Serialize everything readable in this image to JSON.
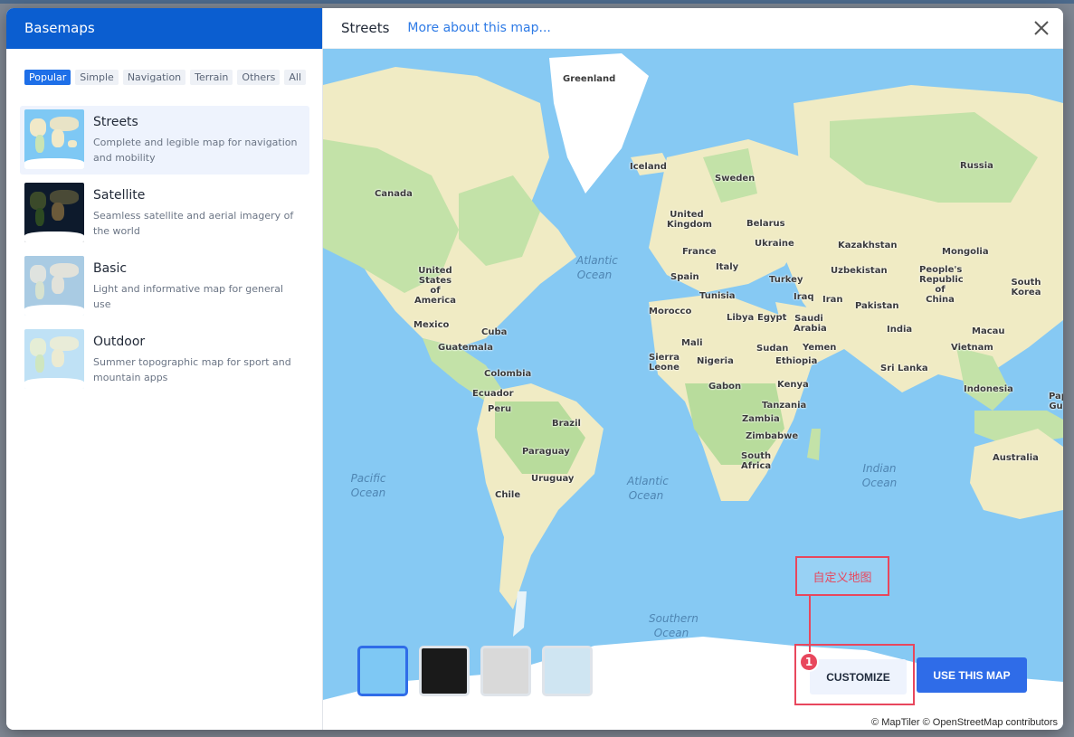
{
  "sidebar": {
    "title": "Basemaps",
    "filters": [
      "Popular",
      "Simple",
      "Navigation",
      "Terrain",
      "Others",
      "All"
    ],
    "active_filter": "Popular",
    "items": [
      {
        "title": "Streets",
        "desc": "Complete and legible map for navigation and mobility",
        "thumb": "streets"
      },
      {
        "title": "Satellite",
        "desc": "Seamless satellite and aerial imagery of the world",
        "thumb": "satellite"
      },
      {
        "title": "Basic",
        "desc": "Light and informative map for general use",
        "thumb": "basic"
      },
      {
        "title": "Outdoor",
        "desc": "Summer topographic map for sport and mountain apps",
        "thumb": "outdoor"
      }
    ]
  },
  "header": {
    "map_name": "Streets",
    "more_link": "More about this map..."
  },
  "map": {
    "labels": {
      "greenland": "Greenland",
      "iceland": "Iceland",
      "canada": "Canada",
      "russia": "Russia",
      "sweden": "Sweden",
      "united_kingdom": "United Kingdom",
      "belarus": "Belarus",
      "france": "France",
      "ukraine": "Ukraine",
      "kazakhstan": "Kazakhstan",
      "mongolia": "Mongolia",
      "spain": "Spain",
      "italy": "Italy",
      "uzbekistan": "Uzbekistan",
      "china": "People's Republic of China",
      "turkey": "Turkey",
      "south_korea": "South Korea",
      "usa": "United States of America",
      "tunisia": "Tunisia",
      "iraq": "Iraq",
      "iran": "Iran",
      "pakistan": "Pakistan",
      "morocco": "Morocco",
      "libya": "Libya",
      "egypt": "Egypt",
      "saudi": "Saudi Arabia",
      "india": "India",
      "macau": "Macau",
      "mexico": "Mexico",
      "cuba": "Cuba",
      "guatemala": "Guatemala",
      "mali": "Mali",
      "sudan": "Sudan",
      "yemen": "Yemen",
      "vietnam": "Vietnam",
      "sierra_leone": "Sierra Leone",
      "nigeria": "Nigeria",
      "ethiopia": "Ethiopia",
      "sri_lanka": "Sri Lanka",
      "colombia": "Colombia",
      "ecuador": "Ecuador",
      "gabon": "Gabon",
      "kenya": "Kenya",
      "indonesia": "Indonesia",
      "papua": "Papu Gu",
      "peru": "Peru",
      "tanzania": "Tanzania",
      "brazil": "Brazil",
      "zambia": "Zambia",
      "zimbabwe": "Zimbabwe",
      "paraguay": "Paraguay",
      "south_africa": "South Africa",
      "australia": "Australia",
      "uruguay": "Uruguay",
      "chile": "Chile"
    },
    "oceans": {
      "atlantic_north": "Atlantic Ocean",
      "pacific": "Pacific Ocean",
      "atlantic_south": "Atlantic Ocean",
      "indian": "Indian Ocean",
      "southern": "Southern Ocean"
    },
    "attribution": "© MapTiler © OpenStreetMap contributors"
  },
  "actions": {
    "customize": "CUSTOMIZE",
    "use_map": "USE THIS MAP"
  },
  "annotation": {
    "label": "自定义地图",
    "badge": "1",
    "color": "#e8475d"
  },
  "colors": {
    "sidebar_header": "#0b5ed0",
    "primary_button": "#2f6ce8",
    "ocean": "#86c9f3"
  }
}
